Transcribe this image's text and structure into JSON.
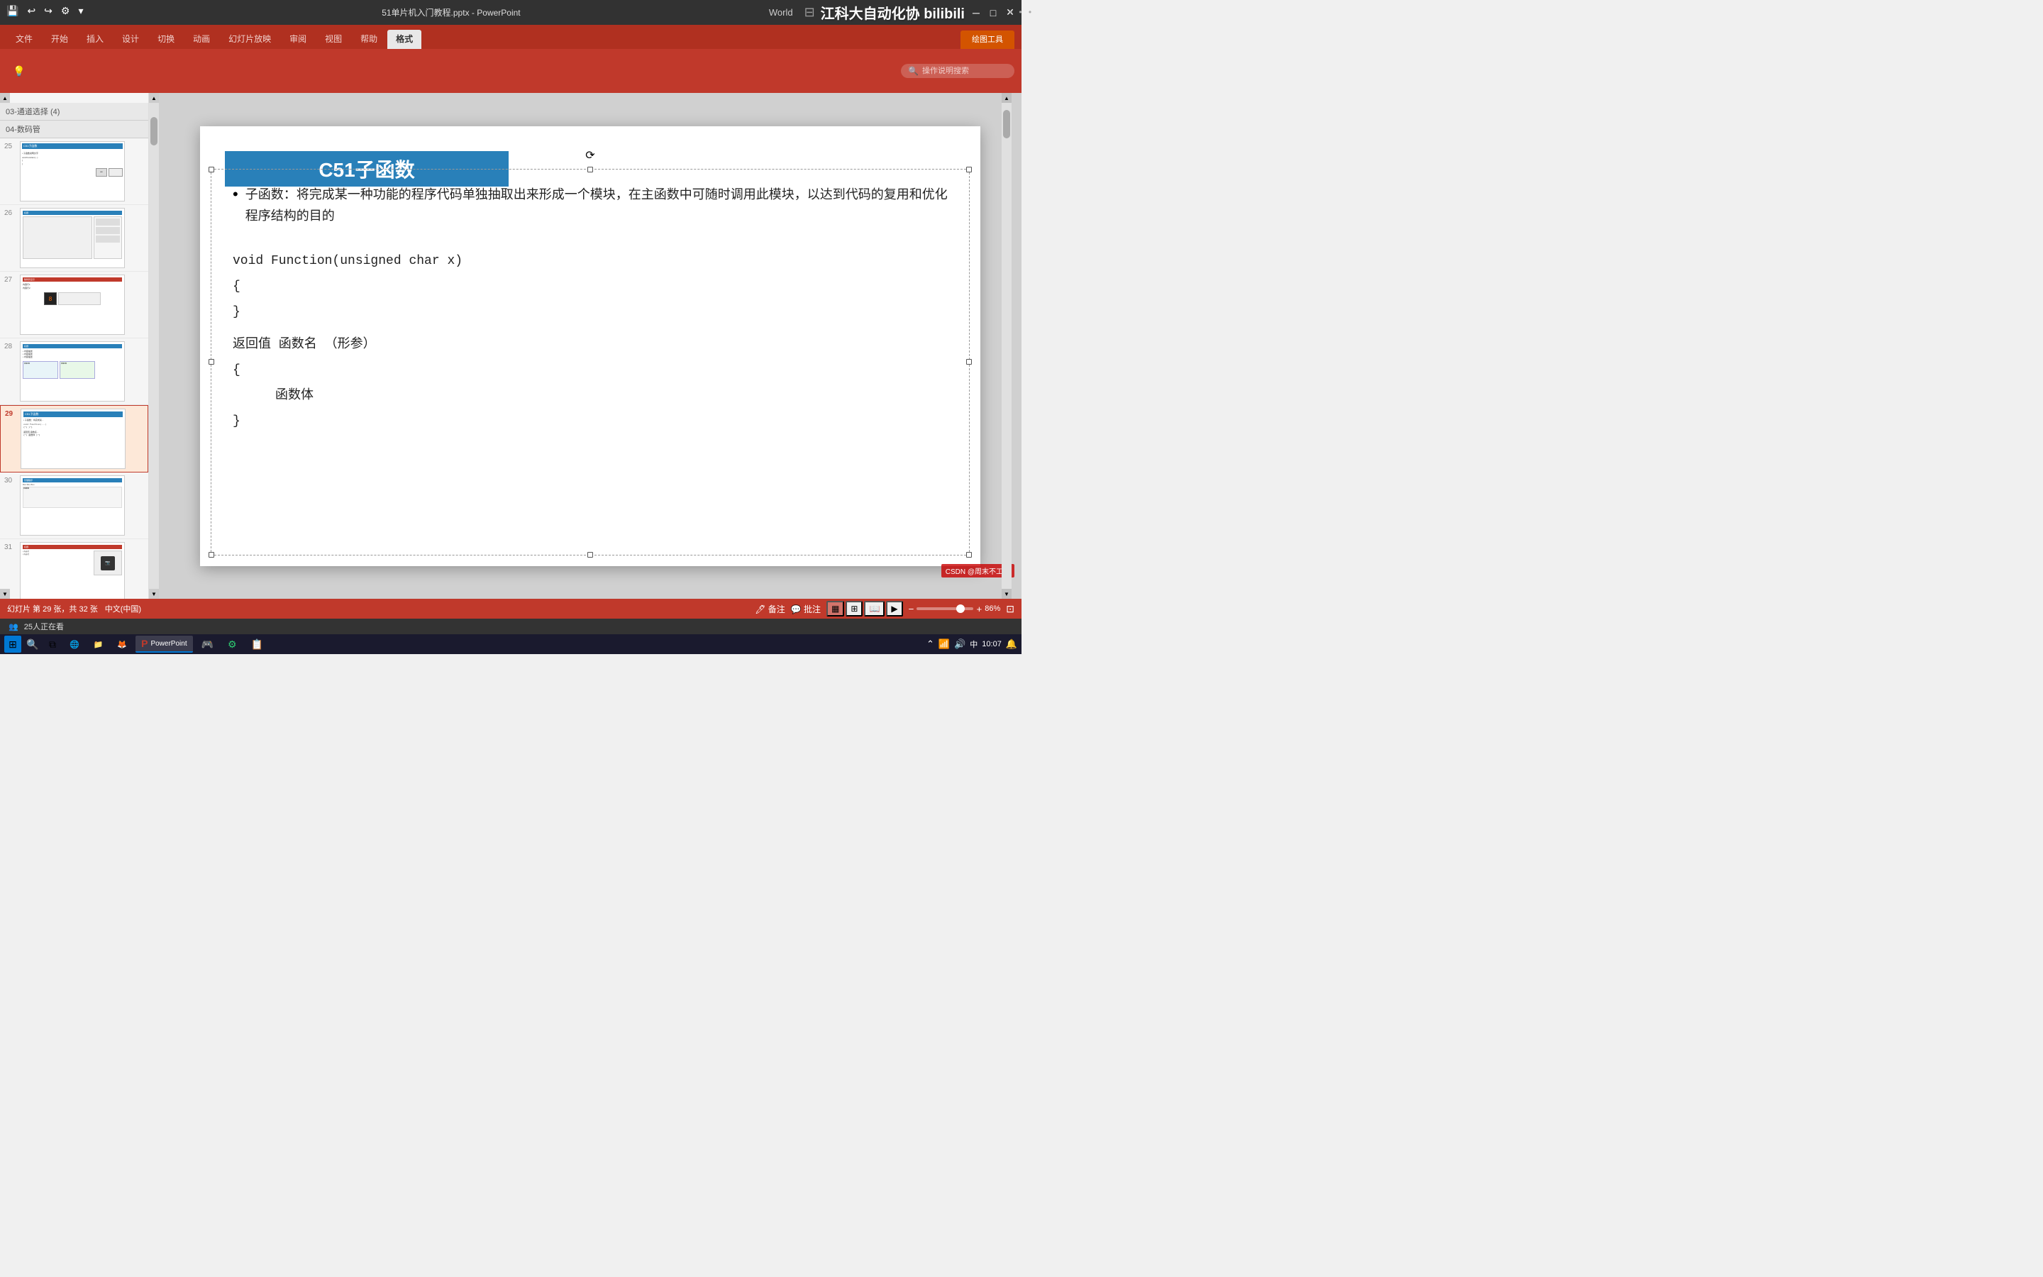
{
  "titlebar": {
    "dots": "• • •",
    "filename": "51单片机入门教程.pptx",
    "separator": " - ",
    "appname": "PowerPoint",
    "world_label": "World",
    "brand": "江科大自动化协 bilibili",
    "minimize": "─",
    "restore": "□",
    "close": "✕"
  },
  "ribbon": {
    "drawing_tools": "绘图工具",
    "tabs": [
      {
        "label": "文件",
        "active": false
      },
      {
        "label": "开始",
        "active": false
      },
      {
        "label": "插入",
        "active": false
      },
      {
        "label": "设计",
        "active": false
      },
      {
        "label": "切换",
        "active": false
      },
      {
        "label": "动画",
        "active": false
      },
      {
        "label": "幻灯片放映",
        "active": false
      },
      {
        "label": "审阅",
        "active": false
      },
      {
        "label": "视图",
        "active": false
      },
      {
        "label": "帮助",
        "active": false
      },
      {
        "label": "格式",
        "active": true
      }
    ],
    "search_placeholder": "操作说明搜索",
    "commands": {
      "save": "💾",
      "undo": "↩",
      "redo": "↪",
      "auto": "⚙"
    }
  },
  "slide_panel": {
    "header_text": "03-通道选择 (4)",
    "header2_text": "04-数码管",
    "slides": [
      {
        "num": "25",
        "active": false
      },
      {
        "num": "26",
        "active": false
      },
      {
        "num": "27",
        "active": false
      },
      {
        "num": "28",
        "active": false
      },
      {
        "num": "29",
        "active": true
      },
      {
        "num": "30",
        "active": false
      },
      {
        "num": "31",
        "active": false
      }
    ]
  },
  "slide": {
    "title": "C51子函数",
    "bullet": "子函数：将完成某一种功能的程序代码单独抽取出来形成一个模块，在主函数中可随时调用此模块，以达到代码的复用和优化程序结构的目的",
    "code1": "void Function(unsigned char x)",
    "code2": "{",
    "code3": "}",
    "code4": "返回值  函数名  （形参）",
    "code5": "{",
    "code6": "    函数体",
    "code7": "}"
  },
  "statusbar": {
    "slide_info": "幻灯片 第 29 张，共 32 张",
    "lang": "中文(中国)",
    "note_btn": "🖊 备注",
    "comment_btn": "💬 批注",
    "zoom": "86%",
    "viewer_count": "25人正在看",
    "csdn_text": "CSDN @周末不工作"
  },
  "taskbar": {
    "time": "10:07",
    "lang_indicator": "中",
    "apps": [
      {
        "icon": "⊞",
        "label": ""
      },
      {
        "icon": "🔍",
        "label": ""
      },
      {
        "icon": "🌐",
        "label": ""
      },
      {
        "icon": "📁",
        "label": ""
      },
      {
        "icon": "🦊",
        "label": ""
      },
      {
        "icon": "P",
        "label": "PowerPoint",
        "active": true
      },
      {
        "icon": "🎮",
        "label": ""
      },
      {
        "icon": "⚙",
        "label": ""
      },
      {
        "icon": "📋",
        "label": ""
      }
    ]
  }
}
